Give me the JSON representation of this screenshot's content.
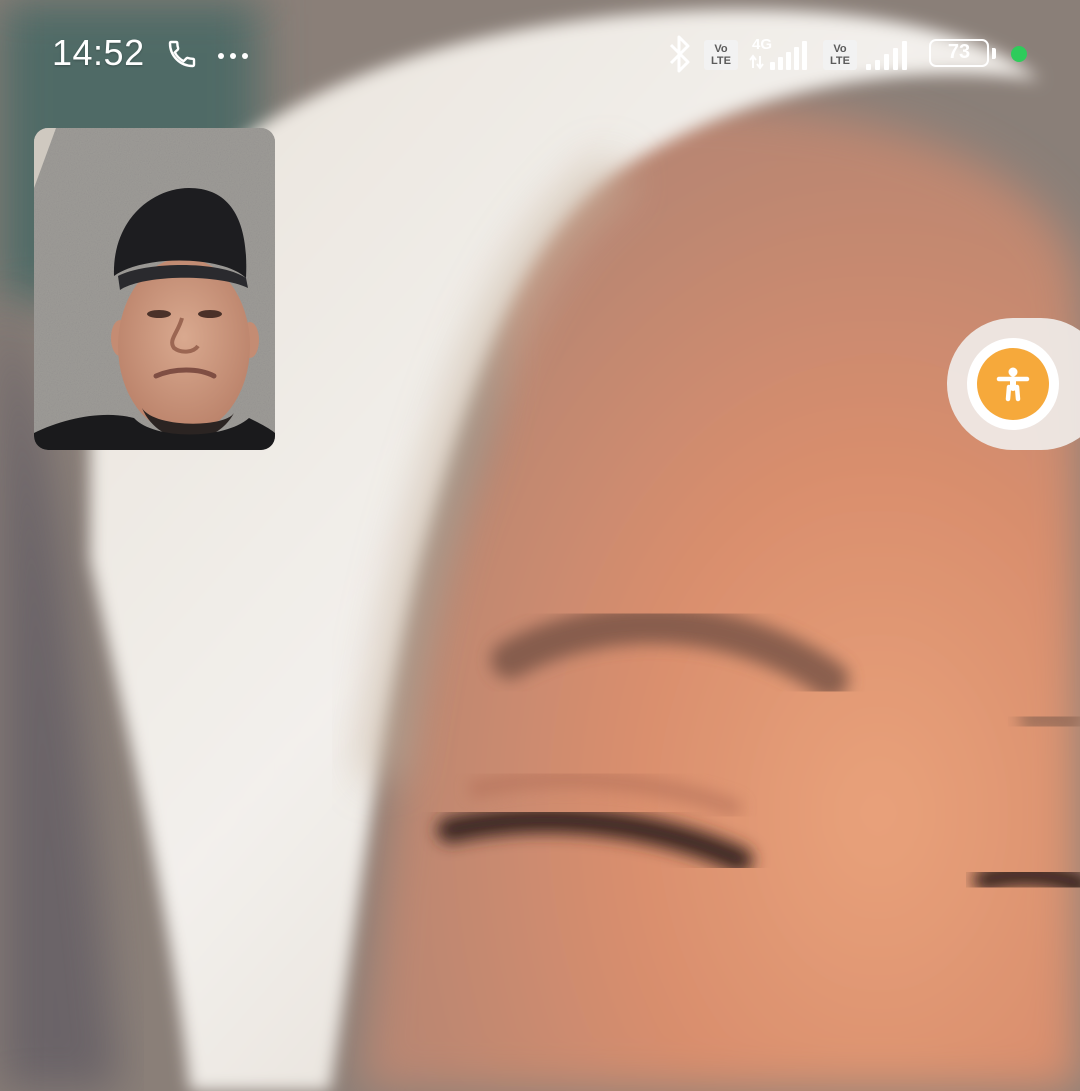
{
  "status_bar": {
    "time": "14:52",
    "icons": [
      "phone-call-icon",
      "more-dots-icon",
      "bluetooth-icon",
      "volte-icon",
      "4g-icon",
      "signal-icon",
      "volte-icon",
      "signal-icon",
      "battery-icon"
    ],
    "volte_top": "Vo",
    "volte_bottom": "LTE",
    "network_type": "4G",
    "battery_level": "73",
    "indicator_color": "#2ecc5b"
  },
  "video_call": {
    "remote_video": "remote-participant-video",
    "self_view": "self-camera-preview"
  },
  "accessibility": {
    "icon": "accessibility-person-icon",
    "accent_color": "#f6a93b"
  }
}
